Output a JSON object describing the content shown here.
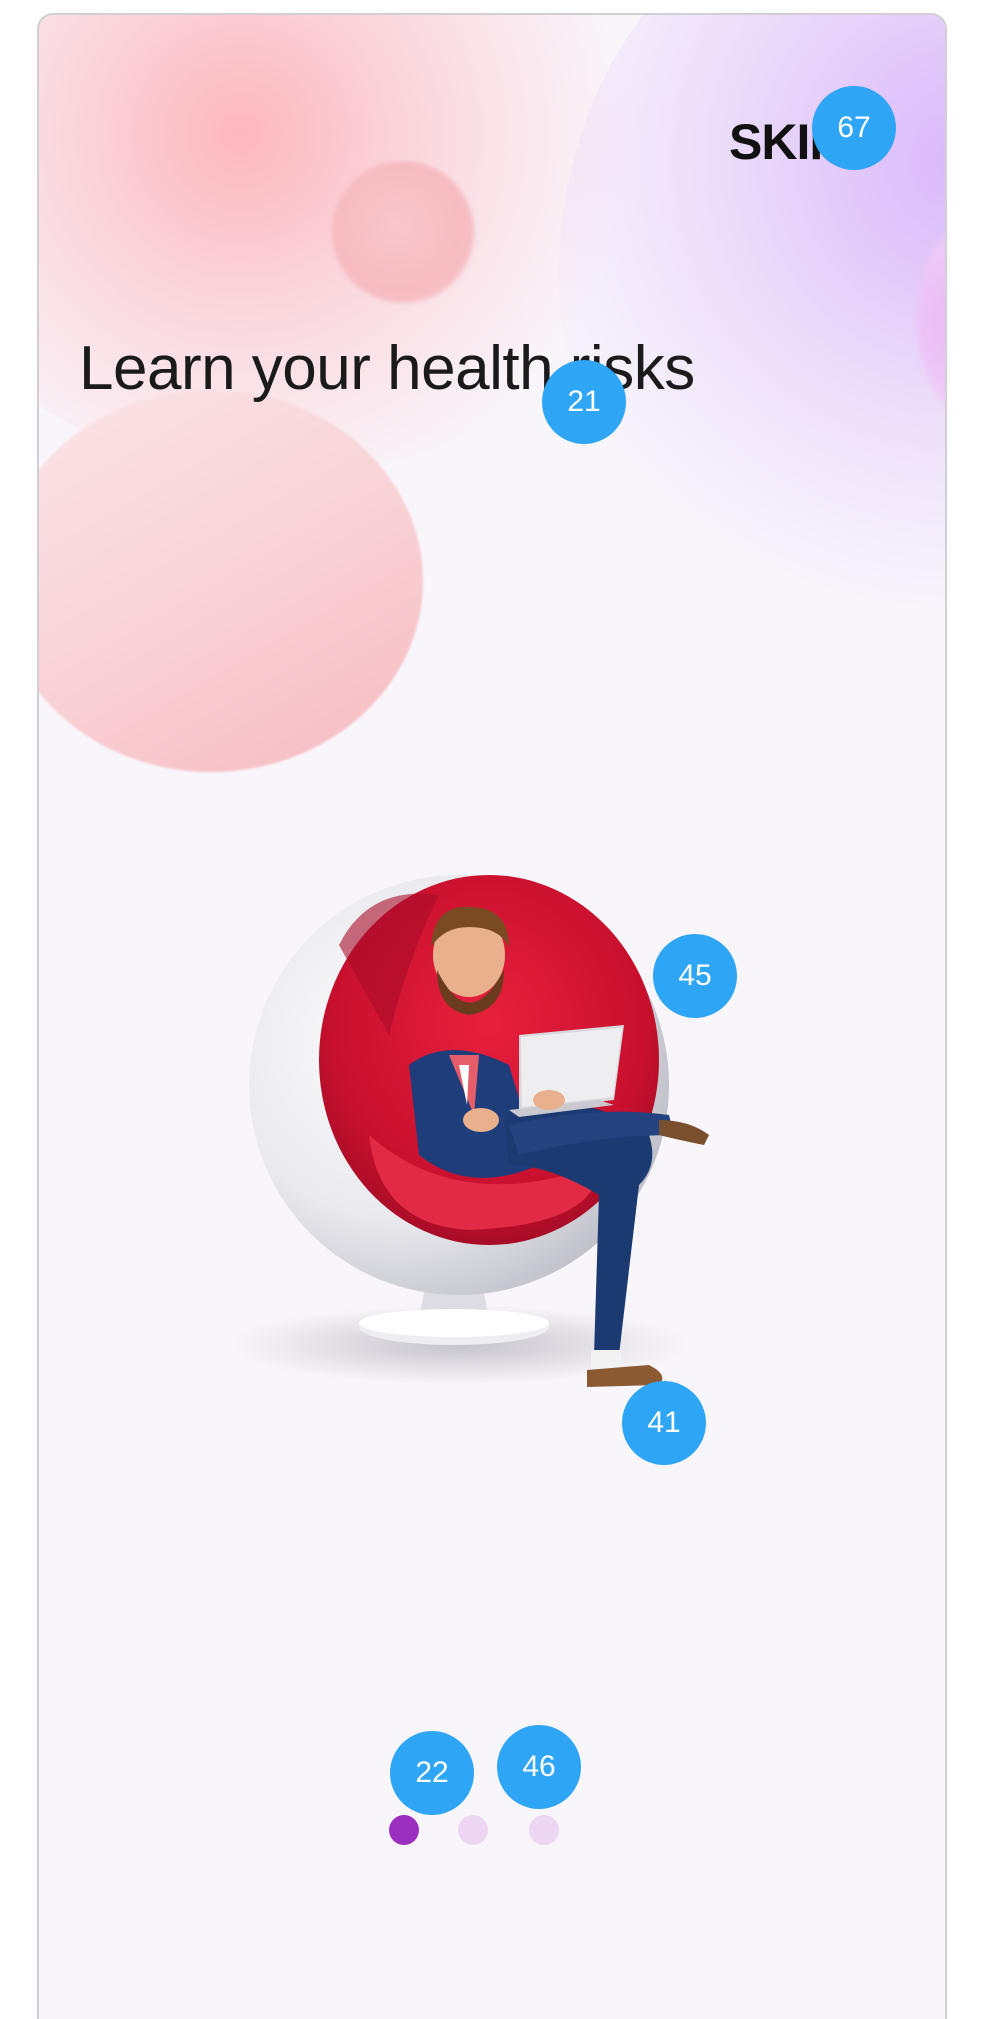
{
  "screen": {
    "skip_label": "SKIP",
    "title": "Learn your health risks"
  },
  "pager": {
    "total": 3,
    "active_index": 0
  },
  "badges": [
    "67",
    "21",
    "45",
    "41",
    "22",
    "46"
  ],
  "colors": {
    "active_dot": "#9b2fc0",
    "inactive_dot": "#ecd6f1",
    "badge": "#2fa5f5",
    "background": "#f9f6fb"
  },
  "icons": {
    "illustration": "man-in-egg-chair-with-laptop-illustration"
  }
}
